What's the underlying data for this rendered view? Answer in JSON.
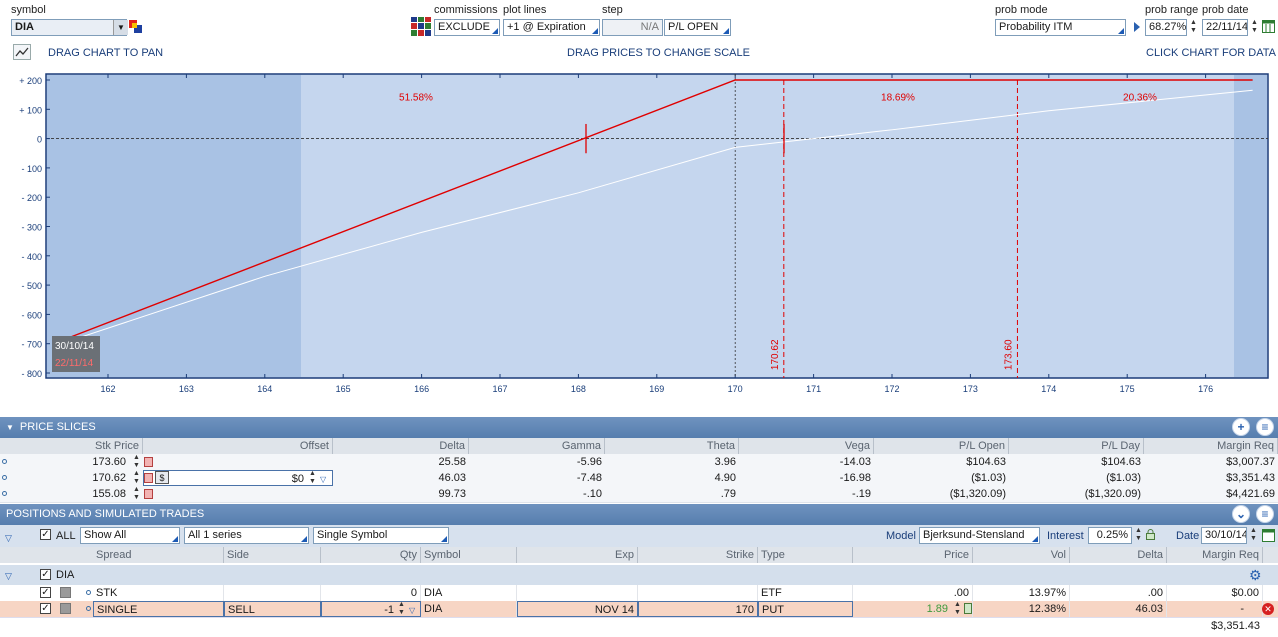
{
  "toolbar": {
    "symbol_label": "symbol",
    "symbol_value": "DIA",
    "commissions_label": "commissions",
    "commissions_value": "EXCLUDE",
    "plot_lines_label": "plot lines",
    "plot_lines_value": "+1 @ Expiration",
    "step_label": "step",
    "step_value": "N/A",
    "pl_mode_value": "P/L OPEN",
    "prob_mode_label": "prob mode",
    "prob_mode_value": "Probability ITM",
    "prob_range_label": "prob range",
    "prob_range_value": "68.27%",
    "prob_date_label": "prob date",
    "prob_date_value": "22/11/14"
  },
  "hints": {
    "pan": "DRAG CHART TO PAN",
    "scale": "DRAG PRICES TO CHANGE SCALE",
    "data": "CLICK CHART FOR DATA"
  },
  "chart_data": {
    "type": "line",
    "x_ticks": [
      "162",
      "163",
      "164",
      "165",
      "166",
      "167",
      "168",
      "169",
      "170",
      "171",
      "172",
      "173",
      "174",
      "175",
      "176"
    ],
    "y_ticks": [
      "+ 200",
      "+ 100",
      "0",
      "- 100",
      "- 200",
      "- 300",
      "- 400",
      "- 500",
      "- 600",
      "- 700",
      "- 800"
    ],
    "xlim": [
      161.4,
      176.8
    ],
    "ylim": [
      -820,
      200
    ],
    "series": [
      {
        "color": "#e00000",
        "points": [
          [
            161.4,
            -690
          ],
          [
            170.0,
            200
          ],
          [
            176.6,
            200
          ]
        ]
      },
      {
        "color": "#ffffff",
        "points": [
          [
            161.4,
            -700
          ],
          [
            164.0,
            -470
          ],
          [
            166.0,
            -320
          ],
          [
            168.0,
            -185
          ],
          [
            170.0,
            -30
          ],
          [
            172.0,
            30
          ],
          [
            174.0,
            95
          ],
          [
            176.6,
            165
          ]
        ]
      }
    ],
    "prob_labels": [
      "51.58%",
      "18.69%",
      "20.36%"
    ],
    "price_markers": [
      "170.62",
      "173.60"
    ],
    "date_box": [
      "30/10/14",
      "22/11/14"
    ]
  },
  "price_slices": {
    "title": "PRICE SLICES",
    "columns": [
      "Stk Price",
      "Offset",
      "Delta",
      "Gamma",
      "Theta",
      "Vega",
      "P/L Open",
      "P/L Day",
      "Margin Req"
    ],
    "rows": [
      {
        "stk": "173.60",
        "offset": "",
        "delta": "25.58",
        "gamma": "-5.96",
        "theta": "3.96",
        "vega": "-14.03",
        "pl_open": "$104.63",
        "pl_day": "$104.63",
        "margin": "$3,007.37"
      },
      {
        "stk": "170.62",
        "offset": "$0",
        "delta": "46.03",
        "gamma": "-7.48",
        "theta": "4.90",
        "vega": "-16.98",
        "pl_open": "($1.03)",
        "pl_day": "($1.03)",
        "margin": "$3,351.43"
      },
      {
        "stk": "155.08",
        "offset": "",
        "delta": "99.73",
        "gamma": "-.10",
        "theta": ".79",
        "vega": "-.19",
        "pl_open": "($1,320.09)",
        "pl_day": "($1,320.09)",
        "margin": "$4,421.69"
      }
    ]
  },
  "positions": {
    "title": "POSITIONS AND SIMULATED TRADES",
    "all_label": "ALL",
    "show_value": "Show All",
    "series_value": "All 1 series",
    "symbol_mode": "Single Symbol",
    "model_label": "Model",
    "model_value": "Bjerksund-Stensland",
    "interest_label": "Interest",
    "interest_value": "0.25%",
    "date_label": "Date",
    "date_value": "30/10/14",
    "columns": [
      "Spread",
      "Side",
      "Qty",
      "Symbol",
      "Exp",
      "Strike",
      "Type",
      "Price",
      "Vol",
      "Delta",
      "Margin Req"
    ],
    "group": "DIA",
    "rows": [
      {
        "spread": "STK",
        "side": "",
        "qty": "0",
        "symbol": "DIA",
        "exp": "",
        "strike": "",
        "type": "ETF",
        "price": ".00",
        "vol": "13.97%",
        "delta": ".00",
        "margin": "$0.00"
      },
      {
        "spread": "SINGLE",
        "side": "SELL",
        "qty": "-1",
        "symbol": "DIA",
        "exp": "NOV 14",
        "strike": "170",
        "type": "PUT",
        "price": "1.89",
        "vol": "12.38%",
        "delta": "46.03",
        "margin": "-"
      }
    ],
    "total_margin": "$3,351.43"
  },
  "colors": {
    "header_blue": "#5d84b4",
    "chart_bg": "#c5d6ee",
    "chart_side": "#a9c2e4",
    "pl_red": "#e00000",
    "sell_row": "#f7d5c4"
  }
}
